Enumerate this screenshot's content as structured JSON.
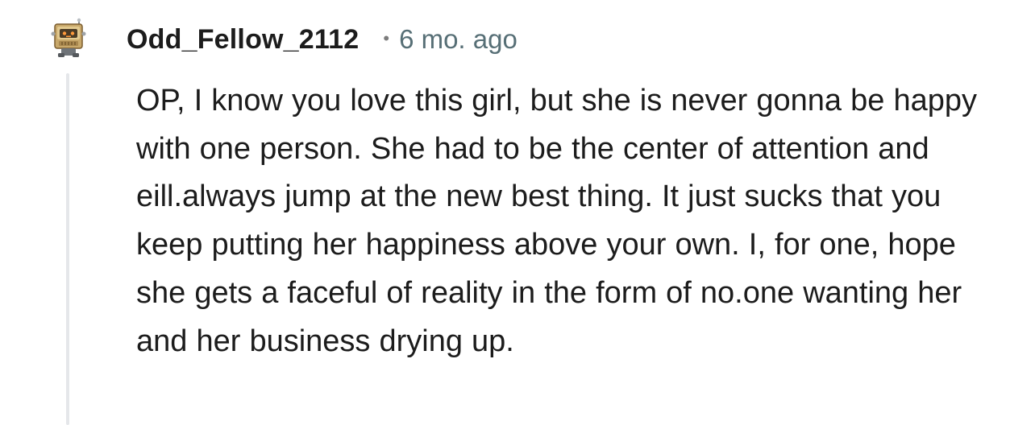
{
  "comment": {
    "author": "Odd_Fellow_2112",
    "separator": "•",
    "timestamp": "6 mo. ago",
    "avatar_icon": "robot-snoo-avatar-icon",
    "body": "OP, I know you love this girl, but she is never gonna be happy with one person. She had to be the center of attention and eill.always jump at the new best thing. It just sucks that you keep putting her happiness above your own. I, for one, hope she gets a faceful of reality in the form of no.one wanting her and her business drying up."
  },
  "colors": {
    "username": "#1c1c1c",
    "meta": "#576f76",
    "thread_line": "#e5e7ea",
    "background": "#ffffff"
  }
}
